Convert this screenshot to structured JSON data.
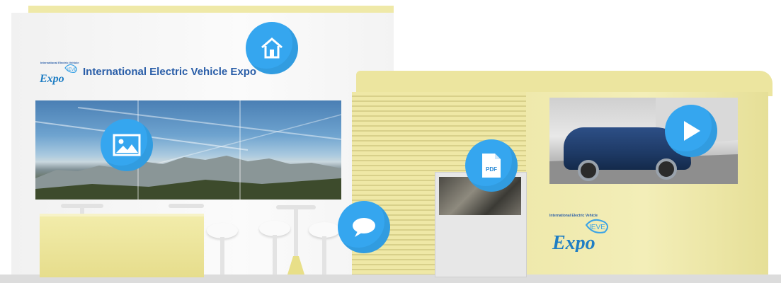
{
  "booth": {
    "title": "International Electric Vehicle Expo",
    "logo_top_text": "International Electric Vehicle",
    "logo_badge": "IEVE",
    "logo_word": "Expo"
  },
  "icons": {
    "home": "home-icon",
    "image": "image-icon",
    "pdf": "pdf-icon",
    "pdf_label": "PDF",
    "chat": "chat-icon",
    "play": "play-icon"
  },
  "colors": {
    "icon_blue": "#35a6ef",
    "booth_yellow": "#ece59f",
    "title_blue": "#2a5ea8"
  }
}
